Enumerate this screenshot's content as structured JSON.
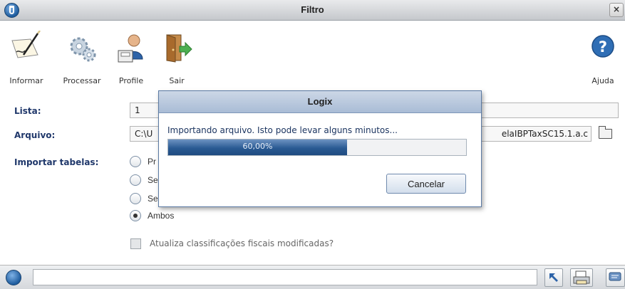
{
  "window": {
    "title": "Filtro",
    "close_glyph": "×"
  },
  "toolbar": {
    "buttons": [
      {
        "label": "Informar",
        "icon": "pencil-paper-icon"
      },
      {
        "label": "Processar",
        "icon": "gears-icon"
      },
      {
        "label": "Profile",
        "icon": "user-profile-icon"
      },
      {
        "label": "Sair",
        "icon": "exit-door-icon"
      }
    ],
    "help": {
      "label": "Ajuda",
      "icon": "help-icon",
      "glyph": "?"
    }
  },
  "form": {
    "lista_label": "Lista:",
    "lista_value": "1",
    "arquivo_label": "Arquivo:",
    "arquivo_value_left": "C:\\U",
    "arquivo_value_right": "elaIBPTaxSC15.1.a.c",
    "importar_label": "Importar tabelas:",
    "options": [
      "Pr",
      "Se",
      "Se",
      "Ambos"
    ],
    "selected": "Ambos",
    "checkbox_label": "Atualiza classificações fiscais modificadas?",
    "checkbox_checked": false
  },
  "modal": {
    "title": "Logix",
    "message": "Importando arquivo. Isto pode levar alguns minutos...",
    "progress_percent": 60,
    "progress_text": "60,00%",
    "cancel_label": "Cancelar"
  },
  "colors": {
    "label_blue": "#20386b",
    "progress_blue": "#2a5a93",
    "title_bar": "#c5c8cc"
  }
}
